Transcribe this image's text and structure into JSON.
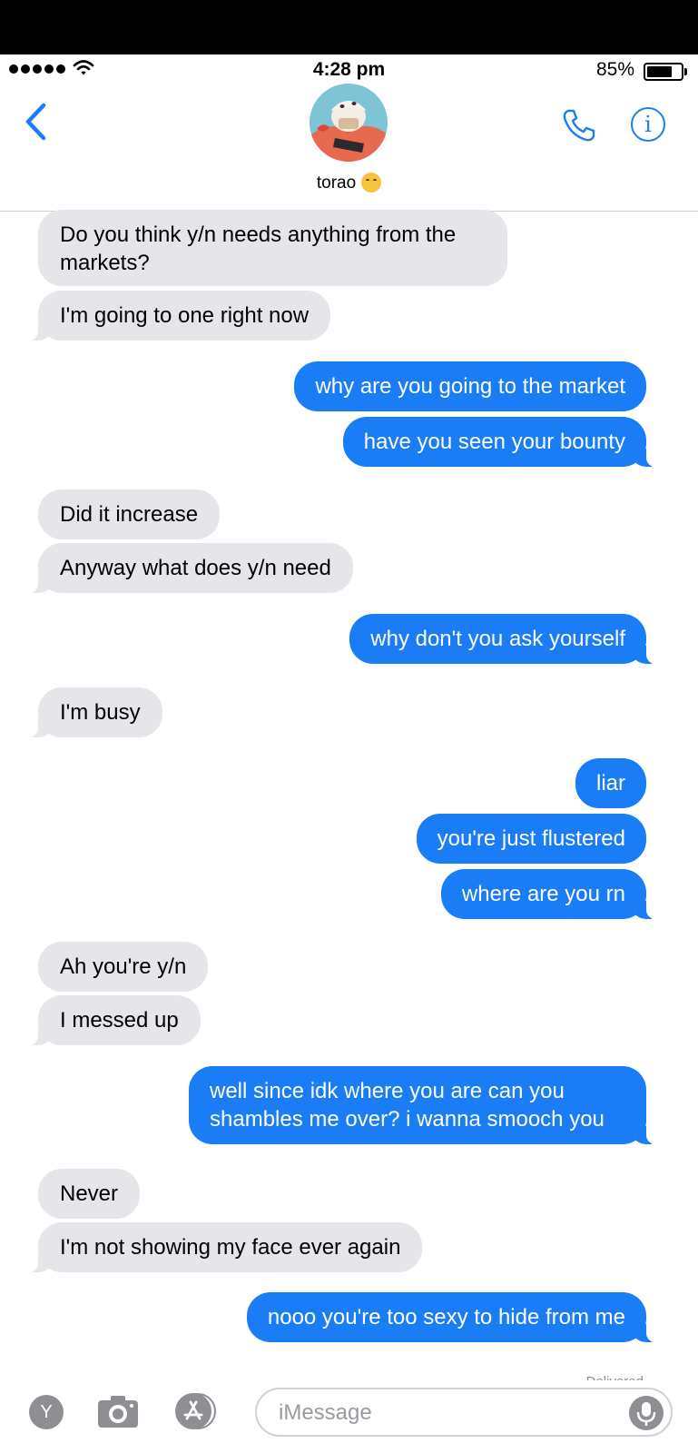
{
  "status_bar": {
    "time": "4:28 pm",
    "battery_percent": "85%",
    "battery_level": 0.85
  },
  "header": {
    "contact_name": "torao",
    "contact_emoji": "blush-smile-emoji"
  },
  "messages": [
    {
      "from": "contact",
      "text": "Do you think y/n needs anything from the markets?"
    },
    {
      "from": "contact",
      "text": "I'm going to one right now"
    },
    {
      "from": "me",
      "text": "why are you going to the market"
    },
    {
      "from": "me",
      "text": "have you seen your bounty"
    },
    {
      "from": "contact",
      "text": "Did it increase"
    },
    {
      "from": "contact",
      "text": "Anyway what does y/n need"
    },
    {
      "from": "me",
      "text": "why don't you ask yourself"
    },
    {
      "from": "contact",
      "text": "I'm busy"
    },
    {
      "from": "me",
      "text": "liar"
    },
    {
      "from": "me",
      "text": "you're just flustered"
    },
    {
      "from": "me",
      "text": "where are you rn"
    },
    {
      "from": "contact",
      "text": "Ah you're y/n"
    },
    {
      "from": "contact",
      "text": "I messed up"
    },
    {
      "from": "me",
      "text": "well since idk where you are can you shambles me over? i wanna smooch you"
    },
    {
      "from": "contact",
      "text": "Never"
    },
    {
      "from": "contact",
      "text": "I'm not showing my face ever again"
    },
    {
      "from": "me",
      "text": "nooo you're too sexy to hide from me"
    }
  ],
  "delivered_label": "Delivered",
  "input": {
    "placeholder": "iMessage",
    "app_drawer_label": "Y"
  },
  "colors": {
    "accent": "#1b7df5",
    "incoming_bubble": "#e5e5ea",
    "icon_gray": "#8e8e93"
  }
}
